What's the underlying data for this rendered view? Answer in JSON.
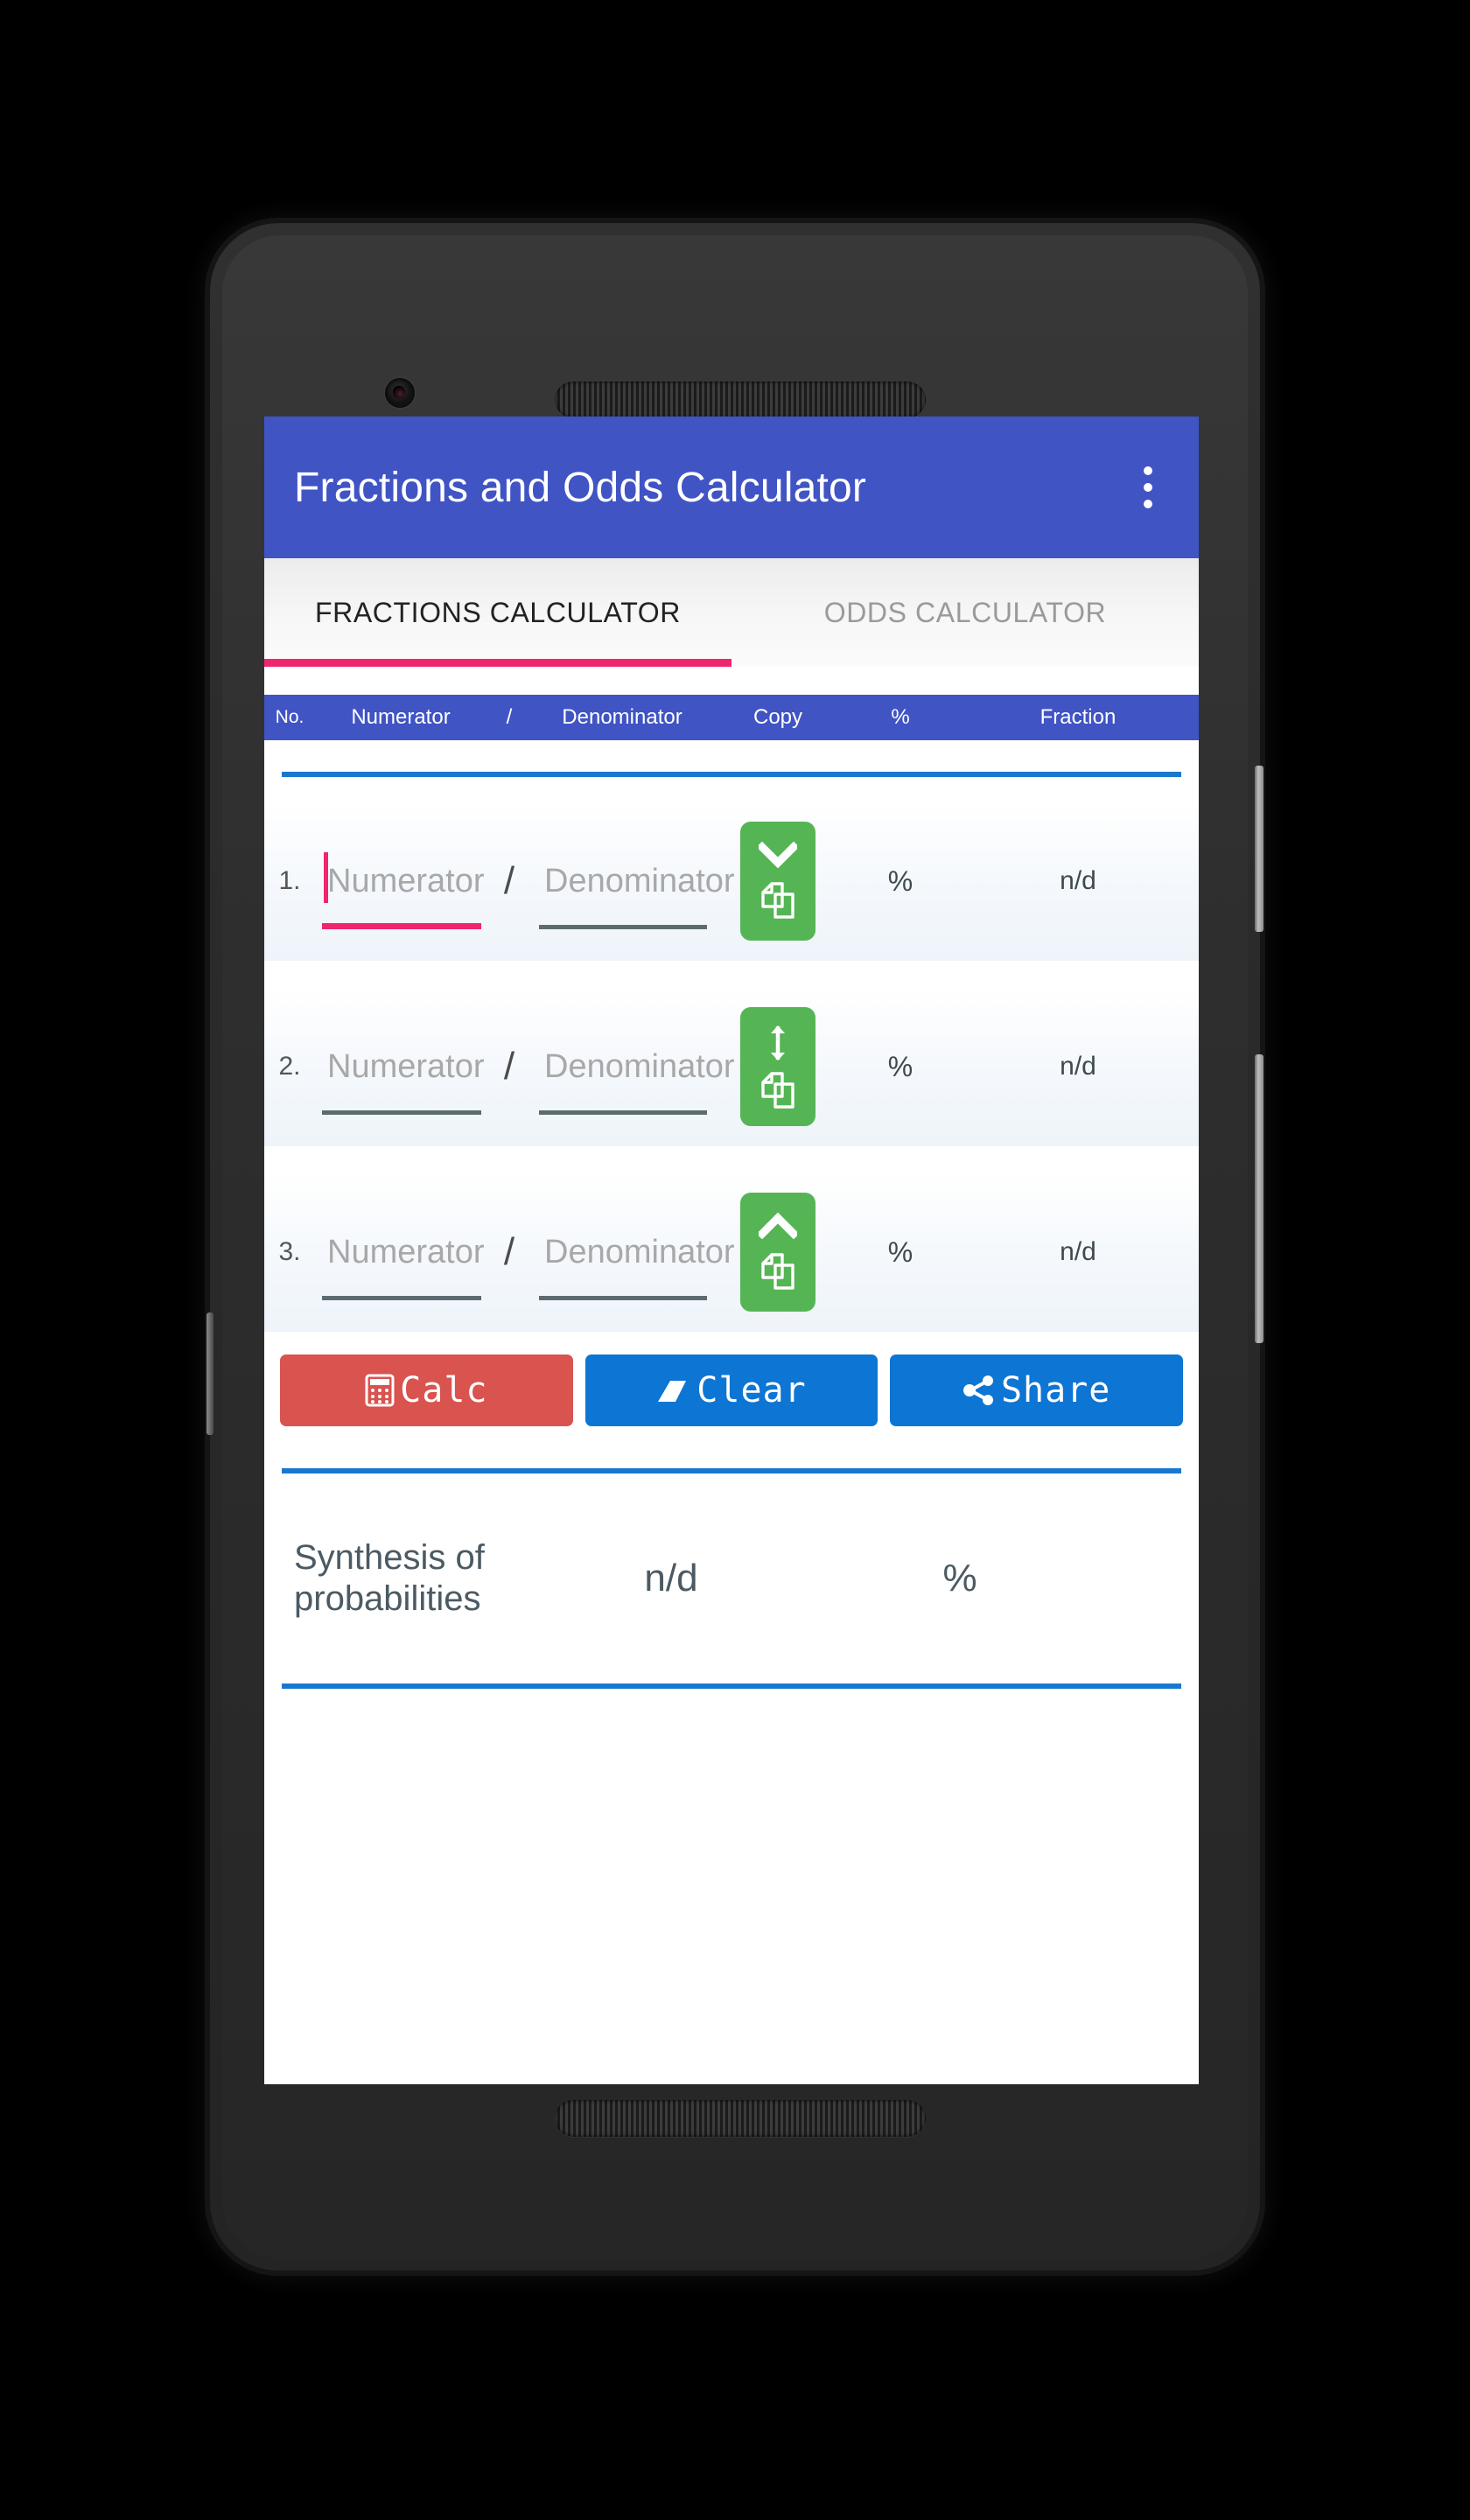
{
  "app": {
    "title": "Fractions and Odds Calculator",
    "overflow_menu_icon": "overflow-menu-icon",
    "appbar_color": "#4054c4",
    "accent_pink": "#f0256f",
    "divider_blue": "#1878d0"
  },
  "tabs": [
    {
      "label": "FRACTIONS CALCULATOR",
      "active": true
    },
    {
      "label": "ODDS CALCULATOR",
      "active": false
    }
  ],
  "columns": {
    "no": "No.",
    "numerator": "Numerator",
    "slash": "/",
    "denominator": "Denominator",
    "copy": "Copy",
    "percent": "%",
    "fraction": "Fraction"
  },
  "rows": [
    {
      "index": "1.",
      "numerator_value": "",
      "numerator_placeholder": "Numerator",
      "denominator_value": "",
      "denominator_placeholder": "Denominator",
      "slash": "/",
      "focused": true,
      "copy_icon": "copy-icon",
      "arrow_icon": "chevron-down-icon",
      "percent": "%",
      "fraction": "n/d"
    },
    {
      "index": "2.",
      "numerator_value": "",
      "numerator_placeholder": "Numerator",
      "denominator_value": "",
      "denominator_placeholder": "Denominator",
      "slash": "/",
      "focused": false,
      "copy_icon": "copy-icon",
      "arrow_icon": "arrows-up-down-icon",
      "percent": "%",
      "fraction": "n/d"
    },
    {
      "index": "3.",
      "numerator_value": "",
      "numerator_placeholder": "Numerator",
      "denominator_value": "",
      "denominator_placeholder": "Denominator",
      "slash": "/",
      "focused": false,
      "copy_icon": "copy-icon",
      "arrow_icon": "chevron-up-icon",
      "percent": "%",
      "fraction": "n/d"
    }
  ],
  "actions": [
    {
      "label": "Calc",
      "icon": "calculator-icon",
      "color": "#d9534f"
    },
    {
      "label": "Clear",
      "icon": "eraser-icon",
      "color": "#0d75d4"
    },
    {
      "label": "Share",
      "icon": "share-icon",
      "color": "#0d75d4"
    }
  ],
  "synthesis": {
    "label_line1": "Synthesis of",
    "label_line2": "probabilities",
    "fraction": "n/d",
    "percent": "%"
  },
  "device": {
    "camera_icon": "front-camera",
    "earpiece_icon": "earpiece-speaker",
    "bottom_speaker_icon": "bottom-speaker",
    "power_button": "power-button",
    "volume_button": "volume-rocker"
  }
}
